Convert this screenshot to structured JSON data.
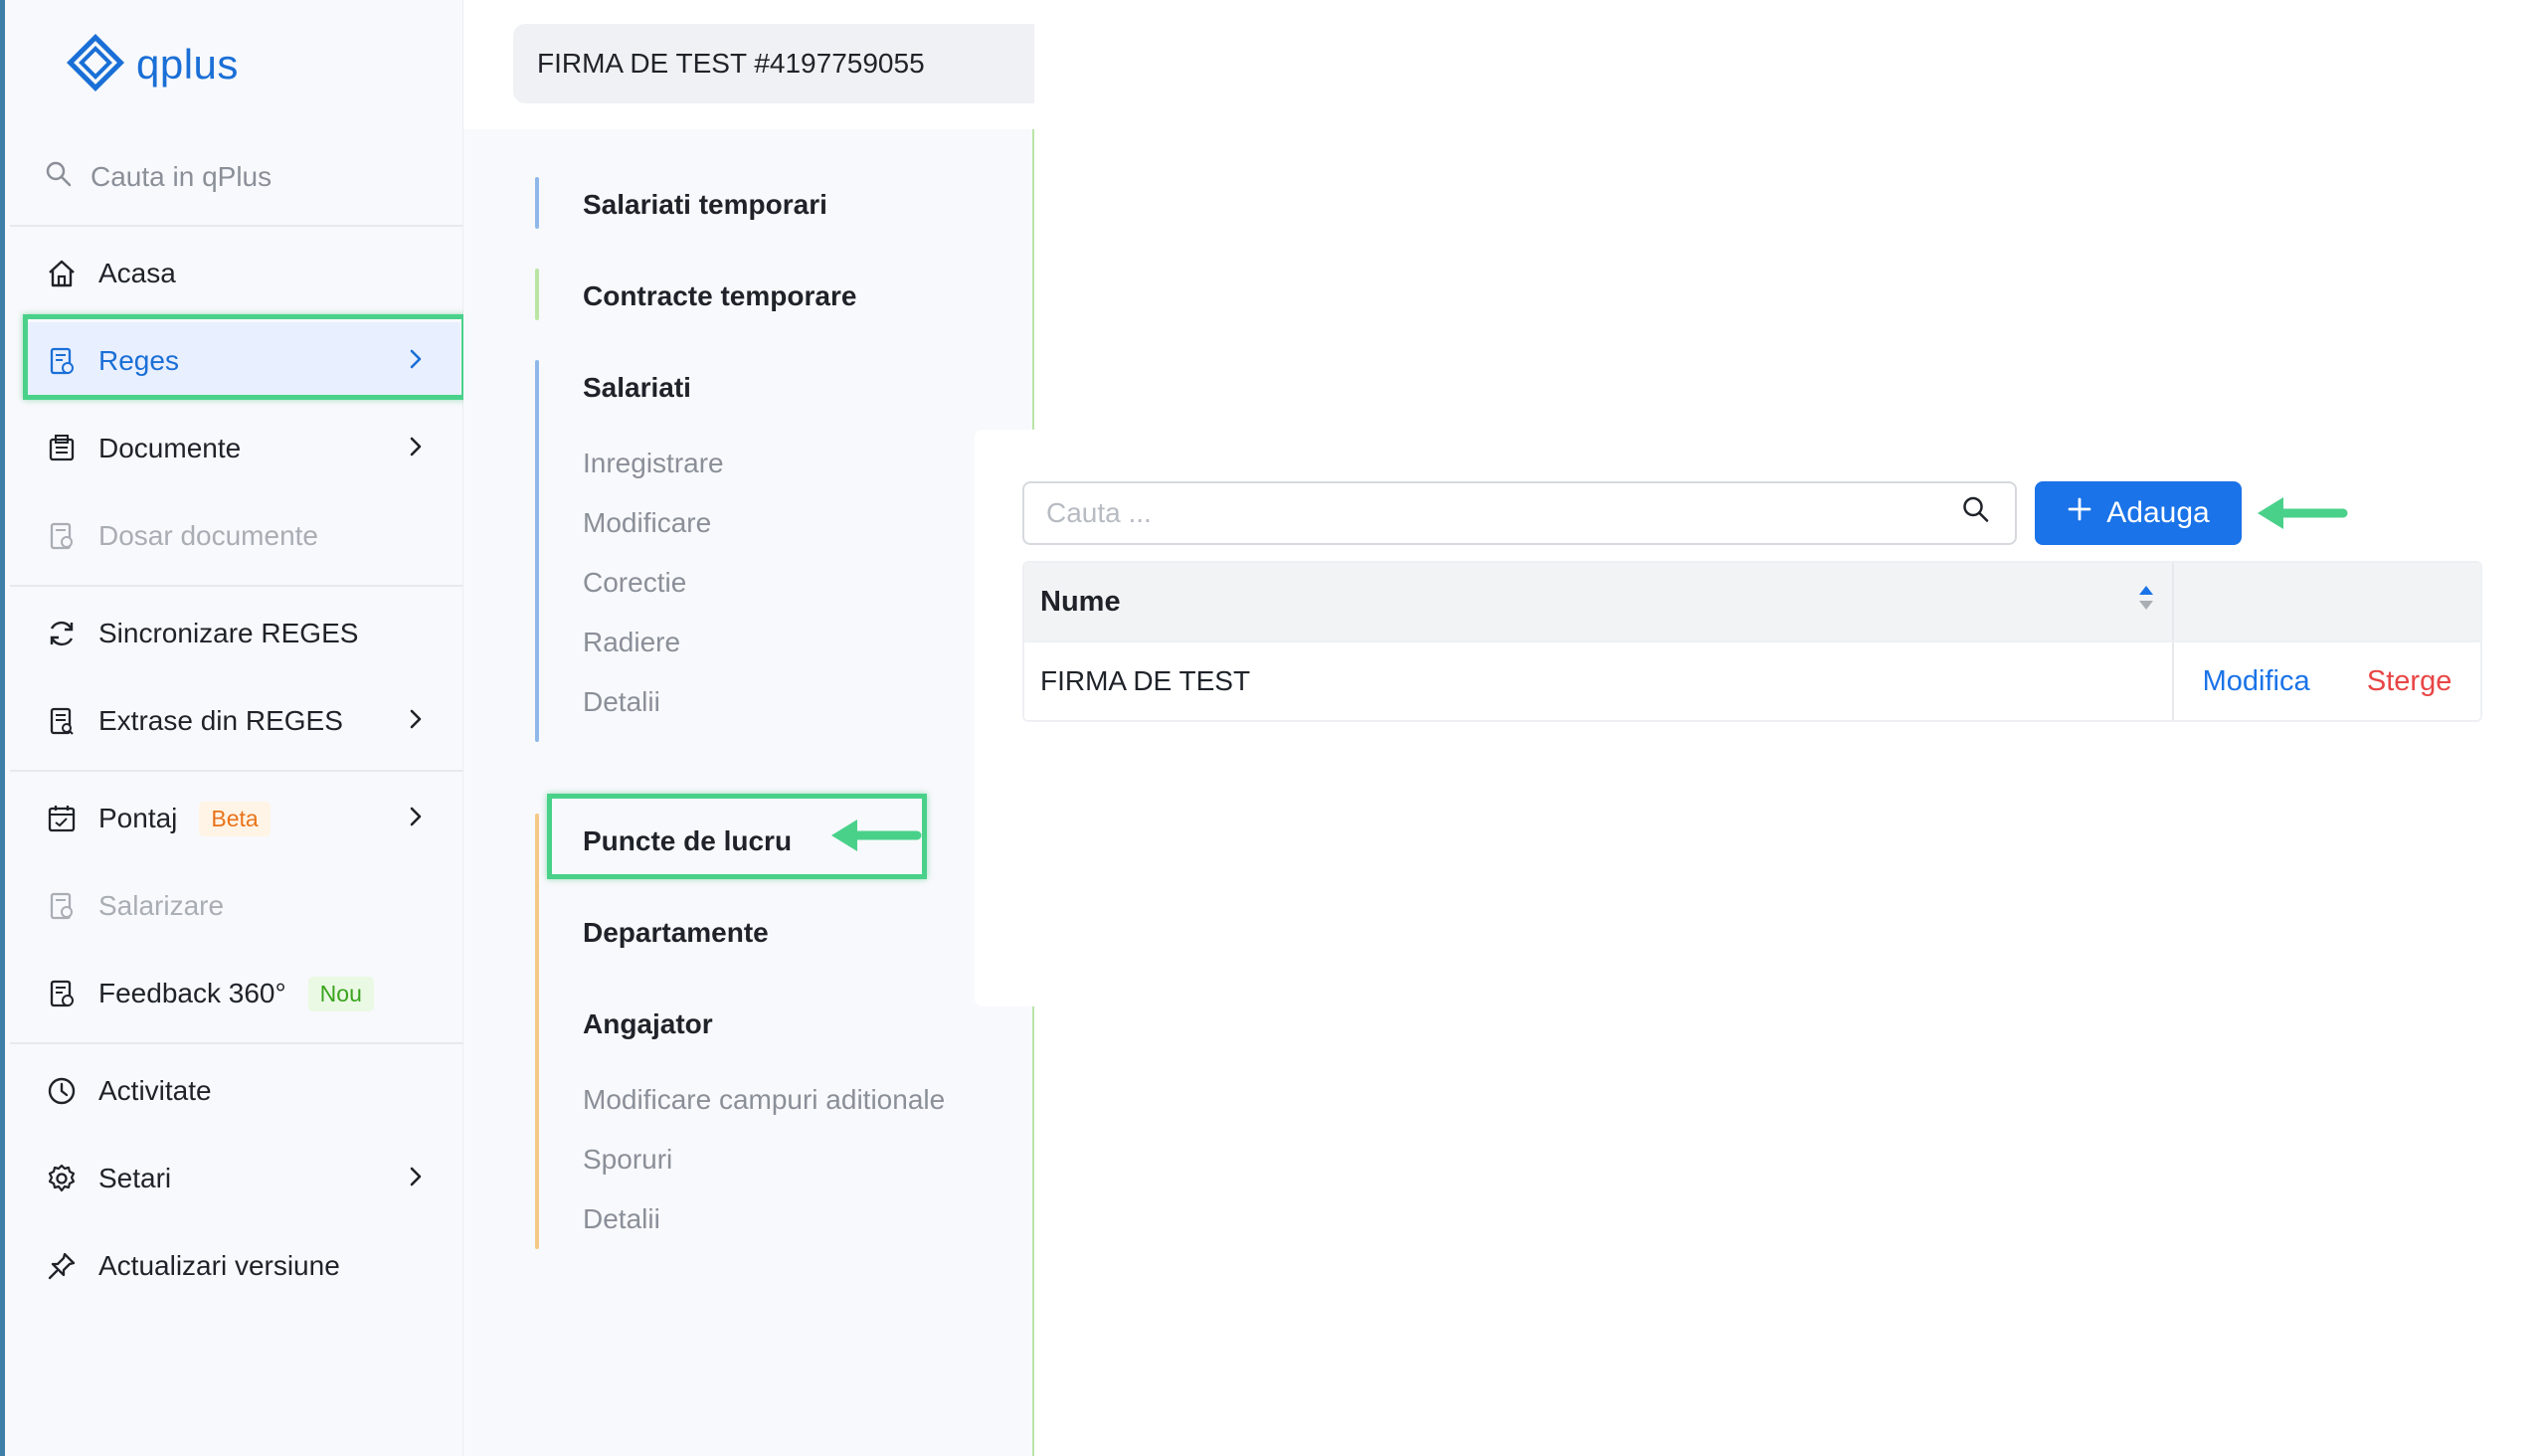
{
  "app": {
    "name": "qplus"
  },
  "sidebar": {
    "search_placeholder": "Cauta in qPlus",
    "items": [
      {
        "label": "Acasa"
      },
      {
        "label": "Reges"
      },
      {
        "label": "Documente"
      },
      {
        "label": "Dosar documente"
      },
      {
        "label": "Sincronizare REGES"
      },
      {
        "label": "Extrase din REGES"
      },
      {
        "label": "Pontaj",
        "badge": "Beta"
      },
      {
        "label": "Salarizare"
      },
      {
        "label": "Feedback 360°",
        "badge": "Nou"
      },
      {
        "label": "Activitate"
      },
      {
        "label": "Setari"
      },
      {
        "label": "Actualizari versiune"
      }
    ]
  },
  "company": {
    "name": "FIRMA DE TEST #4197759055"
  },
  "submenu": {
    "salariati_temporari": "Salariati temporari",
    "contracte_temporare": "Contracte temporare",
    "salariati": {
      "title": "Salariati",
      "links": [
        "Inregistrare",
        "Modificare",
        "Corectie",
        "Radiere",
        "Detalii"
      ]
    },
    "puncte_de_lucru": "Puncte de lucru",
    "departamente": "Departamente",
    "angajator": {
      "title": "Angajator",
      "links": [
        "Modificare campuri aditionale",
        "Sporuri",
        "Detalii"
      ]
    }
  },
  "content": {
    "search_placeholder": "Cauta ...",
    "add_label": "Adauga",
    "table": {
      "columns": [
        "Nume"
      ],
      "rows": [
        {
          "name": "FIRMA DE TEST",
          "edit": "Modifica",
          "delete": "Sterge"
        }
      ]
    }
  },
  "colors": {
    "accent": "#1a73e8",
    "highlight": "#49d18a",
    "danger": "#e84545",
    "beta": "#e8731a",
    "nou": "#3aa31d"
  }
}
